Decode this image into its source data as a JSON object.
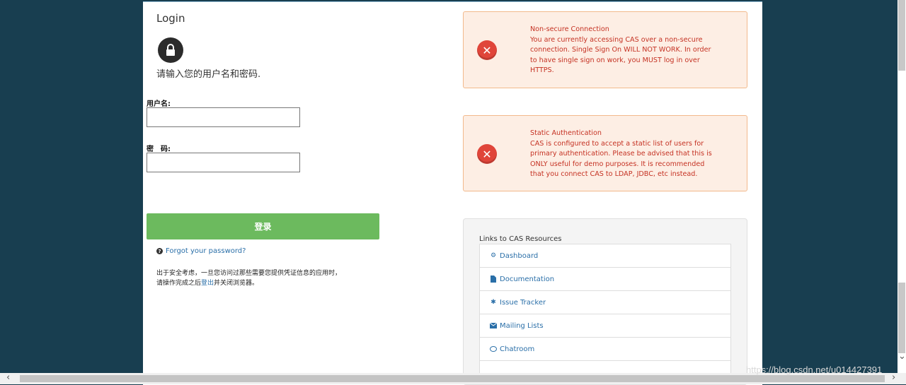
{
  "login": {
    "title": "Login",
    "intro": "请输入您的用户名和密码.",
    "username_label": "用户名:",
    "password_label": "密　码:",
    "username_value": "",
    "password_value": "",
    "submit_label": "登录",
    "forgot_label": "Forgot your password?",
    "note_line1": "出于安全考虑，一旦您访问过那些需要您提供凭证信息的应用时，",
    "note_line2_pre": "请操作完成之后",
    "note_link": "登出",
    "note_line2_post": "并关闭浏览器。"
  },
  "warnings": [
    {
      "title": "Non-secure Connection",
      "lines": [
        "You are currently accessing CAS over a non-secure",
        "connection. Single Sign On WILL NOT WORK. In order",
        "to have single sign on work, you MUST log in over",
        "HTTPS."
      ]
    },
    {
      "title": "Static Authentication",
      "lines": [
        "CAS is configured to accept a static list of users for",
        "primary authentication. Please be advised that this is",
        "ONLY useful for demo purposes. It is recommended",
        "that you connect CAS to LDAP, JDBC, etc instead."
      ]
    }
  ],
  "resources": {
    "title": "Links to CAS Resources",
    "items": [
      {
        "label": "Dashboard",
        "icon": "cogs-icon"
      },
      {
        "label": "Documentation",
        "icon": "file-icon"
      },
      {
        "label": "Issue Tracker",
        "icon": "bug-icon"
      },
      {
        "label": "Mailing Lists",
        "icon": "envelope-icon"
      },
      {
        "label": "Chatroom",
        "icon": "chat-icon"
      }
    ]
  },
  "watermark": "https://blog.csdn.net/u014427391"
}
